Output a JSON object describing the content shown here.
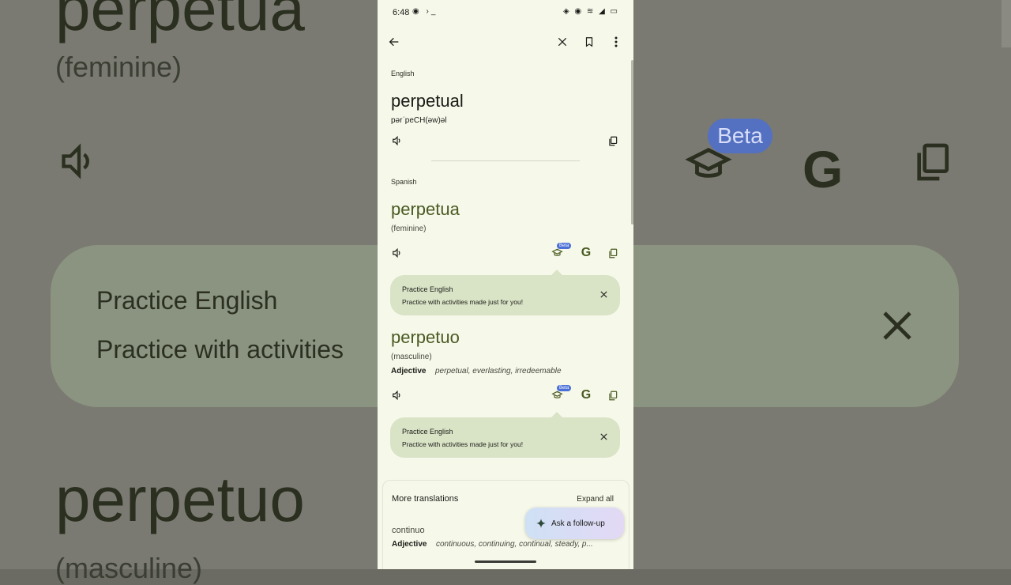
{
  "status": {
    "time": "6:48",
    "left_icons": "◉ ›_",
    "right_icons": "◈ ◉ ≋ ◢ ▭"
  },
  "background": {
    "word1": "perpetua",
    "word1_sub": "(feminine)",
    "word2": "perpetuo",
    "word2_sub": "(masculine)",
    "panel_title": "Practice English",
    "panel_text": "Practice with activities",
    "beta": "Beta"
  },
  "source": {
    "lang": "English",
    "word": "perpetual",
    "phonetic": "pərˈpeCH(əw)əl"
  },
  "target": {
    "lang": "Spanish",
    "entries": [
      {
        "word": "perpetua",
        "gender": "(feminine)",
        "pos": "",
        "synonyms": ""
      },
      {
        "word": "perpetuo",
        "gender": "(masculine)",
        "pos": "Adjective",
        "synonyms": "perpetual, everlasting, irredeemable"
      }
    ],
    "beta_label": "Beta",
    "tip_title": "Practice English",
    "tip_text": "Practice with activities made just for you!"
  },
  "more": {
    "title": "More translations",
    "expand": "Expand all",
    "word": "continuo",
    "pos": "Adjective",
    "synonyms": "continuous, continuing, continual, steady, p..."
  },
  "fab": {
    "label": "Ask a follow-up"
  },
  "colors": {
    "bg": "#f6f8ea",
    "accent": "#4a5a22",
    "tip": "#d9e3c6",
    "beta": "#4a6fd6"
  }
}
